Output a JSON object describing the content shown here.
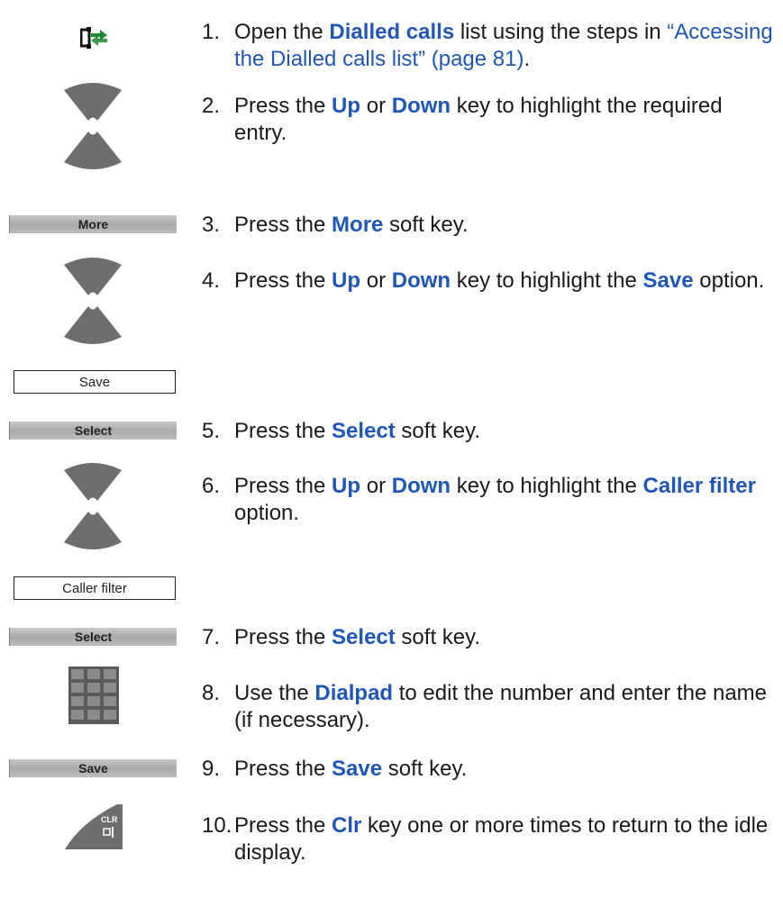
{
  "steps": [
    {
      "num": "1.",
      "pre": "Open the ",
      "bold1": "Dialled calls",
      "mid": " list using the steps in ",
      "link": "“Accessing the Dialled calls list” (page 81)",
      "post": "."
    },
    {
      "num": "2.",
      "pre": "Press the ",
      "bold1": "Up",
      "mid": " or ",
      "bold2": "Down",
      "post": " key to highlight the required entry."
    },
    {
      "num": "3.",
      "pre": "Press the ",
      "bold1": "More",
      "post": " soft key."
    },
    {
      "num": "4.",
      "pre": "Press the ",
      "bold1": "Up",
      "mid": " or ",
      "bold2": "Down",
      "mid2": " key to highlight the ",
      "bold3": "Save",
      "post": " option."
    },
    {
      "num": "5.",
      "pre": "Press the ",
      "bold1": "Select",
      "post": " soft key."
    },
    {
      "num": "6.",
      "pre": "Press the ",
      "bold1": "Up",
      "mid": " or ",
      "bold2": "Down",
      "mid2": " key to highlight the ",
      "bold3": "Caller filter",
      "post": " option."
    },
    {
      "num": "7.",
      "pre": "Press the ",
      "bold1": "Select",
      "post": " soft key."
    },
    {
      "num": "8.",
      "pre": "Use the ",
      "bold1": "Dialpad",
      "post": " to edit the number and enter the name (if necessary)."
    },
    {
      "num": "9.",
      "pre": "Press the ",
      "bold1": "Save",
      "post": " soft key."
    },
    {
      "num": "10.",
      "pre": "Press the ",
      "bold1": "Clr",
      "post": " key one or more times to return to the idle display."
    }
  ],
  "softkeys": {
    "more": "More",
    "select1": "Select",
    "select2": "Select",
    "save": "Save"
  },
  "menu_items": {
    "save": "Save",
    "caller_filter": "Caller filter"
  },
  "clr_key": {
    "line1": "CLR"
  },
  "colors": {
    "highlight": "#1f56b8",
    "nav_key": "#6e6e6e"
  }
}
